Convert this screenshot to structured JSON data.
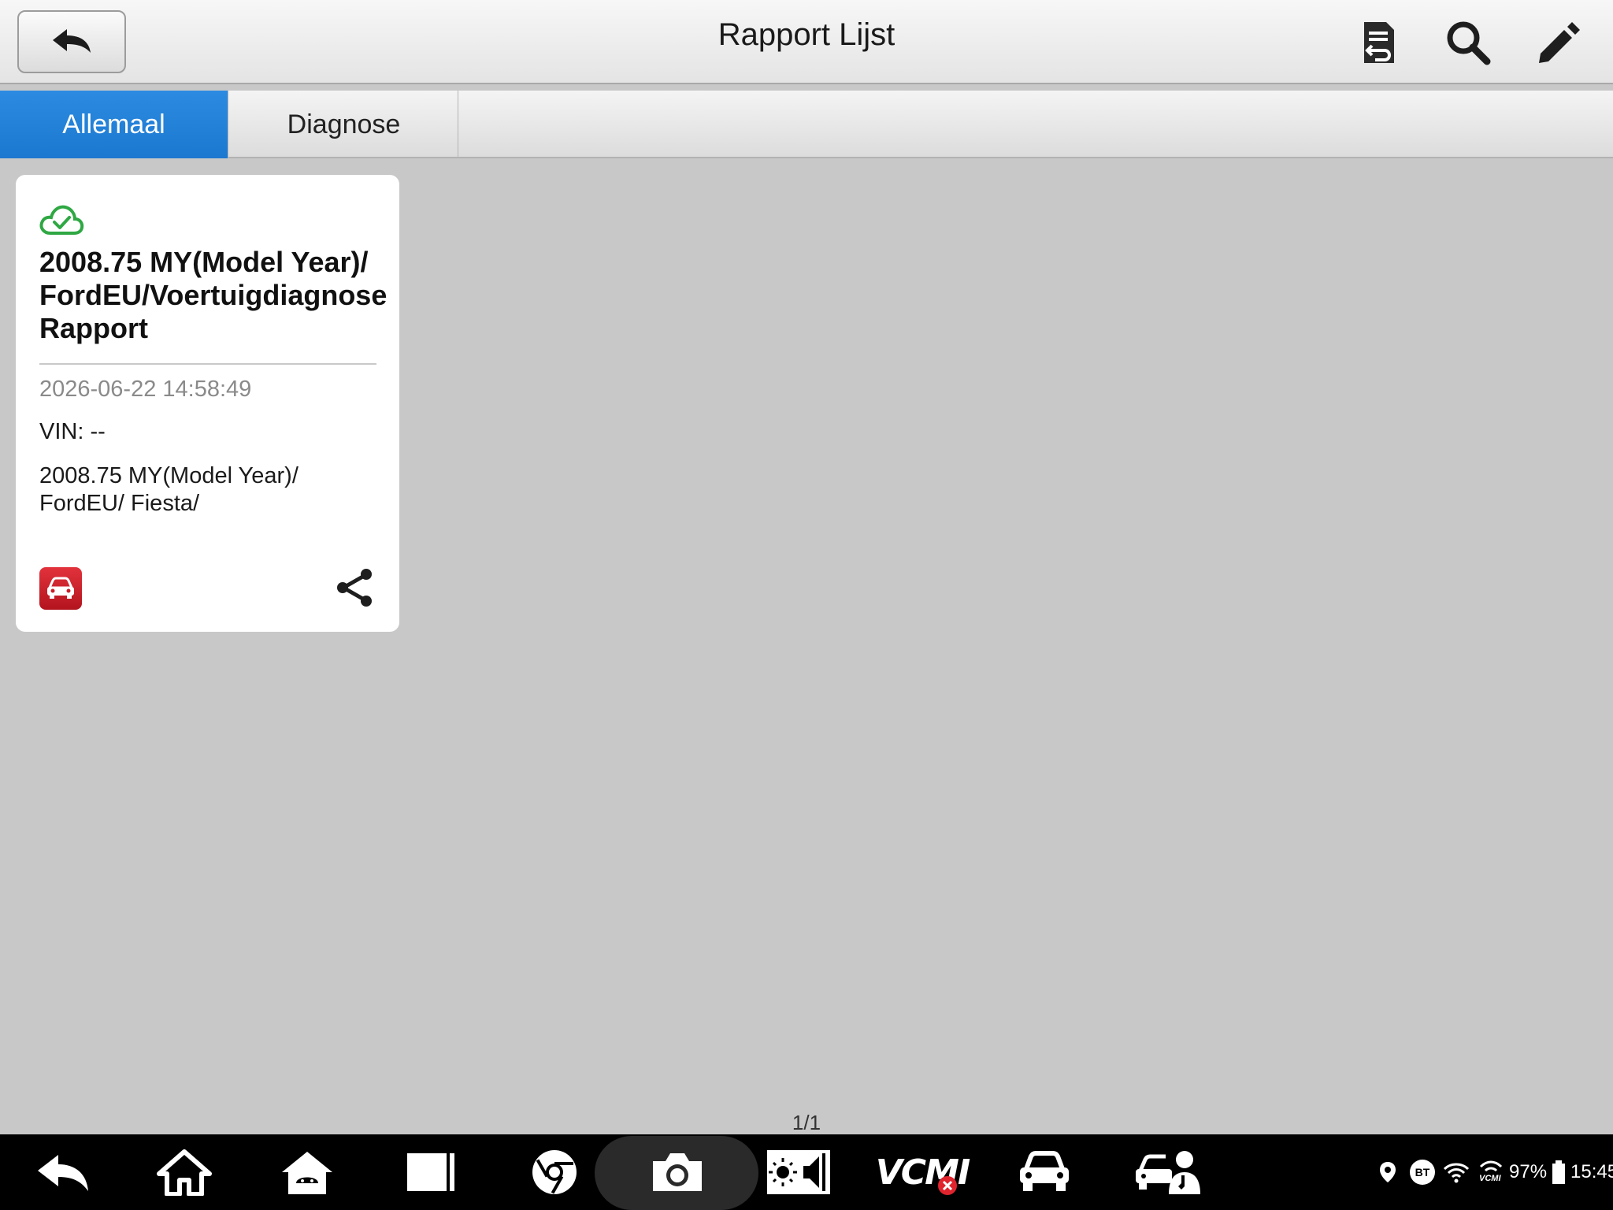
{
  "header": {
    "title": "Rapport Lijst",
    "icons": [
      "report-return-icon",
      "search-icon",
      "edit-pencil-icon"
    ]
  },
  "tabs": [
    {
      "label": "Allemaal",
      "active": true
    },
    {
      "label": "Diagnose",
      "active": false
    }
  ],
  "report_card": {
    "sync_status_icon": "cloud-check-icon",
    "title": "2008.75 MY(Model Year)/ FordEU/Voertuigdiagnose Rapport",
    "date": "2026-06-22 14:58:49",
    "vin": "VIN: --",
    "vehicle_path": "2008.75 MY(Model Year)/ FordEU/ Fiesta/"
  },
  "pagination": "1/1",
  "navbar": {
    "vcm_label": "VCMI",
    "battery": "97%",
    "time": "15:45",
    "bt_label": "BT",
    "vcmi_small": "VCMI"
  },
  "colors": {
    "accent_tab": "#1b78d0",
    "cloud_green": "#2fa843",
    "car_badge_red": "#c81e28"
  }
}
